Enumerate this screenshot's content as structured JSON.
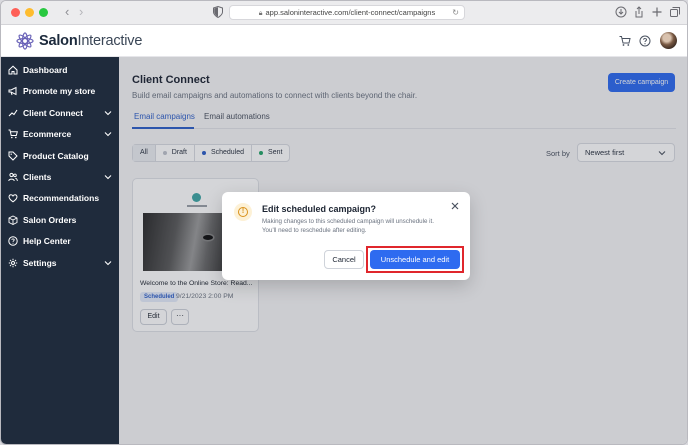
{
  "browser": {
    "url": "app.saloninteractive.com/client-connect/campaigns"
  },
  "header": {
    "logo_bold": "Salon",
    "logo_light": "Interactive"
  },
  "sidebar": {
    "items": [
      {
        "label": "Dashboard",
        "icon": "home-icon",
        "expandable": false
      },
      {
        "label": "Promote my store",
        "icon": "megaphone-icon",
        "expandable": false
      },
      {
        "label": "Client Connect",
        "icon": "trend-icon",
        "expandable": true
      },
      {
        "label": "Ecommerce",
        "icon": "cart-icon",
        "expandable": true
      },
      {
        "label": "Product Catalog",
        "icon": "tag-icon",
        "expandable": false
      },
      {
        "label": "Clients",
        "icon": "users-icon",
        "expandable": true
      },
      {
        "label": "Recommendations",
        "icon": "heart-icon",
        "expandable": false
      },
      {
        "label": "Salon Orders",
        "icon": "box-icon",
        "expandable": false
      },
      {
        "label": "Help Center",
        "icon": "help-icon",
        "expandable": false
      },
      {
        "label": "Settings",
        "icon": "gear-icon",
        "expandable": true
      }
    ]
  },
  "main": {
    "title": "Client Connect",
    "subtitle": "Build email campaigns and automations to connect with clients beyond the chair.",
    "create_button": "Create campaign",
    "tabs": [
      {
        "label": "Email campaigns",
        "active": true
      },
      {
        "label": "Email automations",
        "active": false
      }
    ],
    "filters": [
      {
        "label": "All",
        "dot": null,
        "selected": true
      },
      {
        "label": "Draft",
        "dot": "#c0c4cc",
        "selected": false
      },
      {
        "label": "Scheduled",
        "dot": "#2e5fc9",
        "selected": false
      },
      {
        "label": "Sent",
        "dot": "#25a56a",
        "selected": false
      }
    ],
    "sort_label": "Sort by",
    "sort_value": "Newest first",
    "card": {
      "title": "Welcome to the Online Store: Read...",
      "badge": "Scheduled",
      "date": "9/21/2023 2:00 PM",
      "edit_label": "Edit",
      "more_label": "···"
    }
  },
  "modal": {
    "title": "Edit scheduled campaign?",
    "body": "Making changes to this scheduled campaign will unschedule it. You'll need to reschedule after editing.",
    "cancel_label": "Cancel",
    "confirm_label": "Unschedule and edit",
    "warn_symbol": "!"
  },
  "colors": {
    "primary": "#2e6bf0",
    "sidebar_bg": "#1f2b3c",
    "highlight": "#e0262c"
  }
}
